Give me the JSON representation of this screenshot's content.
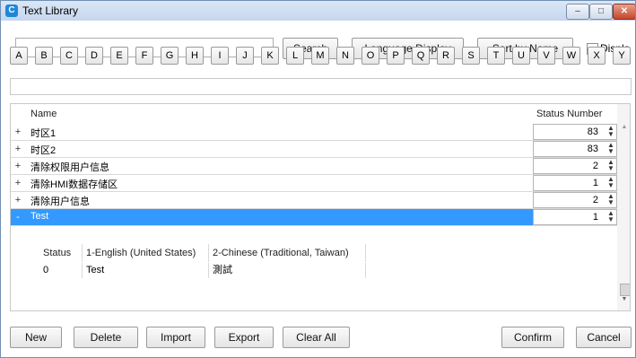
{
  "window": {
    "title": "Text Library",
    "min": "–",
    "max": "□",
    "close": "✕",
    "icon": "app-icon"
  },
  "toolbar": {
    "search_value": "",
    "search_label": "Search",
    "language_display_label": "Language Display",
    "sort_label": "Sort by Name",
    "display_checkbox_label": "Displa"
  },
  "letters": [
    "A",
    "B",
    "C",
    "D",
    "E",
    "F",
    "G",
    "H",
    "I",
    "J",
    "K",
    "L",
    "M",
    "N",
    "O",
    "P",
    "Q",
    "R",
    "S",
    "T",
    "U",
    "V",
    "W",
    "X",
    "Y"
  ],
  "grid": {
    "columns": {
      "name": "Name",
      "status_number": "Status Number"
    },
    "rows": [
      {
        "pm": "+",
        "name": "时区1",
        "value": "83"
      },
      {
        "pm": "+",
        "name": "时区2",
        "value": "83"
      },
      {
        "pm": "+",
        "name": "清除权限用户信息",
        "value": "2"
      },
      {
        "pm": "+",
        "name": "清除HMI数据存储区",
        "value": "1"
      },
      {
        "pm": "+",
        "name": "清除用户信息",
        "value": "2"
      },
      {
        "pm": "-",
        "name": "Test",
        "value": "1",
        "selected": true
      }
    ],
    "subtable": {
      "headers": [
        "Status",
        "1-English (United States)",
        "2-Chinese (Traditional, Taiwan)"
      ],
      "rows": [
        [
          "0",
          "Test",
          "測試"
        ]
      ]
    }
  },
  "buttons": {
    "new": "New",
    "delete": "Delete",
    "import": "Import",
    "export": "Export",
    "clear_all": "Clear All",
    "confirm": "Confirm",
    "cancel": "Cancel"
  },
  "colors": {
    "selection": "#3399ff",
    "title_bar": "#c5d6ee",
    "close_button": "#c7452a"
  }
}
